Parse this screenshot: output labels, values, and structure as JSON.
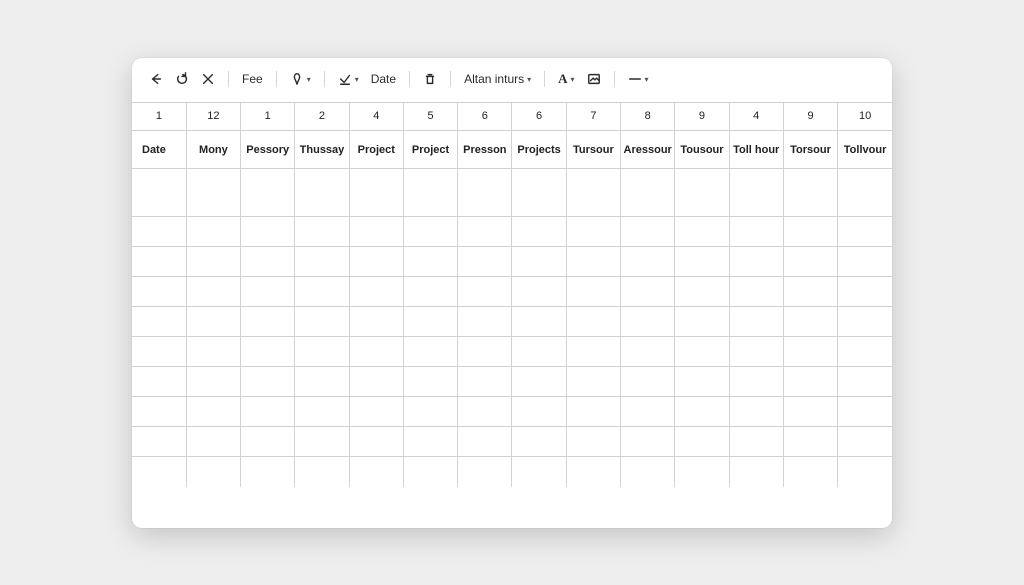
{
  "toolbar": {
    "fee_label": "Fee",
    "date_label": "Date",
    "align_label": "Altan inturs",
    "text_style_label": "A"
  },
  "sheet": {
    "numbers": [
      "1",
      "12",
      "1",
      "2",
      "4",
      "5",
      "6",
      "6",
      "7",
      "8",
      "9",
      "4",
      "9",
      "10"
    ],
    "labels": [
      "Date",
      "Mony",
      "Pessory",
      "Thussay",
      "Project",
      "Project",
      "Presson",
      "Projects",
      "Tursour",
      "Aressour",
      "Tousour",
      "Toll hour",
      "Torsour",
      "Tollvour"
    ],
    "body_row_count": 10
  }
}
